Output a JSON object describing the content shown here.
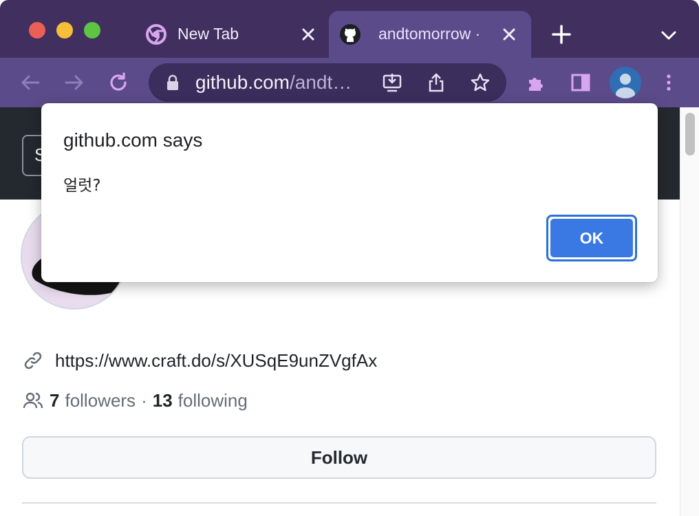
{
  "browser": {
    "tabs": [
      {
        "title": "New Tab",
        "favicon": "chrome-icon",
        "active": false
      },
      {
        "title": "andtomorrow ·",
        "favicon": "github-icon",
        "active": true
      }
    ],
    "address_bar": {
      "host": "github.com",
      "path": "/andt…"
    },
    "colors": {
      "frame": "#41305f",
      "toolbar": "#5c4b8a",
      "omnibox": "#3b2d5c",
      "icon_accent": "#d8a6ee"
    }
  },
  "page": {
    "header_button_letter": "S",
    "profile": {
      "website": "https://www.craft.do/s/XUSqE9unZVgfAx",
      "followers_count": "7",
      "followers_label": "followers",
      "separator": "·",
      "following_count": "13",
      "following_label": "following"
    },
    "follow_button_label": "Follow"
  },
  "dialog": {
    "title": "github.com says",
    "message": "얼럿?",
    "ok_label": "OK",
    "colors": {
      "ok_button": "#3a78e4"
    }
  }
}
